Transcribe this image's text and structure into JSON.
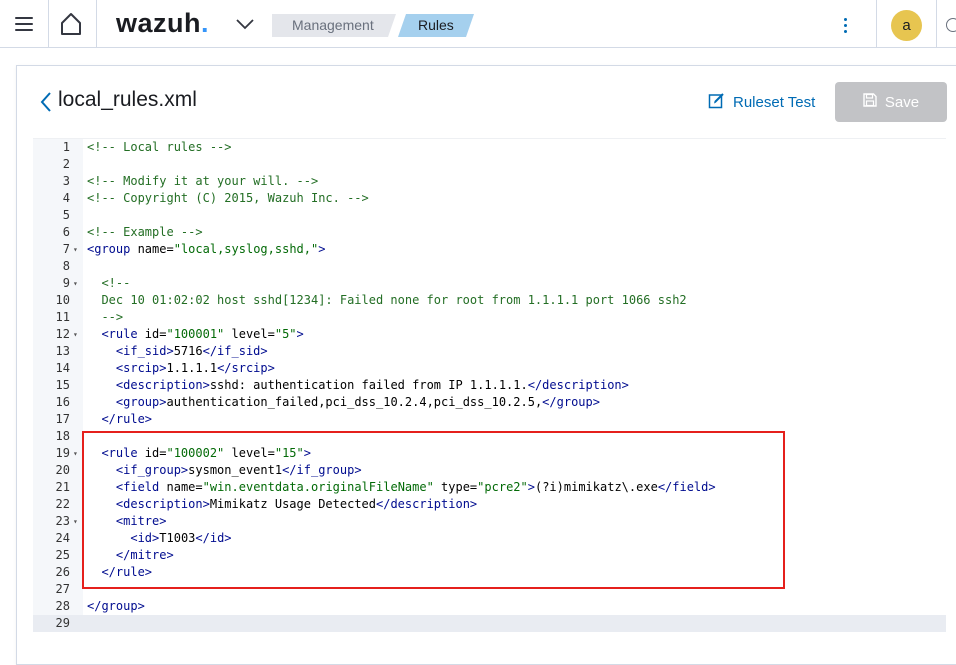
{
  "header": {
    "logo_text": "wazuh",
    "logo_dot": ".",
    "breadcrumbs": [
      "Management",
      "Rules"
    ],
    "avatar_letter": "a"
  },
  "page": {
    "file_name": "local_rules.xml",
    "ruleset_test_label": "Ruleset Test",
    "save_label": "Save"
  },
  "colors": {
    "accent": "#006bb4",
    "logo_dot": "#3595f9",
    "active_crumb": "#a5d0ee",
    "avatar": "#e7c550",
    "highlight_border": "#e5201c"
  },
  "icons": {
    "menu": "hamburger-icon",
    "home": "home-icon",
    "app_switch": "chevron-down-icon",
    "more": "kebab-icon",
    "back": "chevron-left-icon",
    "ruleset": "edit-icon",
    "save": "save-icon"
  },
  "editor": {
    "active_line": 29,
    "lines": [
      {
        "n": "1",
        "fold": false,
        "tokens": [
          [
            "c",
            "<!-- Local rules -->"
          ]
        ]
      },
      {
        "n": "2",
        "fold": false,
        "tokens": []
      },
      {
        "n": "3",
        "fold": false,
        "tokens": [
          [
            "c",
            "<!-- Modify it at your will. -->"
          ]
        ]
      },
      {
        "n": "4",
        "fold": false,
        "tokens": [
          [
            "c",
            "<!-- Copyright (C) 2015, Wazuh Inc. -->"
          ]
        ]
      },
      {
        "n": "5",
        "fold": false,
        "tokens": []
      },
      {
        "n": "6",
        "fold": false,
        "tokens": [
          [
            "c",
            "<!-- Example -->"
          ]
        ]
      },
      {
        "n": "7",
        "fold": true,
        "tokens": [
          [
            "t",
            "<group"
          ],
          [
            "a",
            " name="
          ],
          [
            "v",
            "\"local,syslog,sshd,\""
          ],
          [
            "t",
            ">"
          ]
        ]
      },
      {
        "n": "8",
        "fold": false,
        "tokens": []
      },
      {
        "n": "9",
        "fold": true,
        "tokens": [
          [
            "c",
            "  <!--"
          ]
        ]
      },
      {
        "n": "10",
        "fold": false,
        "tokens": [
          [
            "c",
            "  Dec 10 01:02:02 host sshd[1234]: Failed none for root from 1.1.1.1 port 1066 ssh2"
          ]
        ]
      },
      {
        "n": "11",
        "fold": false,
        "tokens": [
          [
            "c",
            "  -->"
          ]
        ]
      },
      {
        "n": "12",
        "fold": true,
        "tokens": [
          [
            "x",
            "  "
          ],
          [
            "t",
            "<rule"
          ],
          [
            "a",
            " id="
          ],
          [
            "v",
            "\"100001\""
          ],
          [
            "a",
            " level="
          ],
          [
            "v",
            "\"5\""
          ],
          [
            "t",
            ">"
          ]
        ]
      },
      {
        "n": "13",
        "fold": false,
        "tokens": [
          [
            "x",
            "    "
          ],
          [
            "t",
            "<if_sid>"
          ],
          [
            "x",
            "5716"
          ],
          [
            "t",
            "</if_sid>"
          ]
        ]
      },
      {
        "n": "14",
        "fold": false,
        "tokens": [
          [
            "x",
            "    "
          ],
          [
            "t",
            "<srcip>"
          ],
          [
            "x",
            "1.1.1.1"
          ],
          [
            "t",
            "</srcip>"
          ]
        ]
      },
      {
        "n": "15",
        "fold": false,
        "tokens": [
          [
            "x",
            "    "
          ],
          [
            "t",
            "<description>"
          ],
          [
            "x",
            "sshd: authentication failed from IP 1.1.1.1."
          ],
          [
            "t",
            "</description>"
          ]
        ]
      },
      {
        "n": "16",
        "fold": false,
        "tokens": [
          [
            "x",
            "    "
          ],
          [
            "t",
            "<group>"
          ],
          [
            "x",
            "authentication_failed,pci_dss_10.2.4,pci_dss_10.2.5,"
          ],
          [
            "t",
            "</group>"
          ]
        ]
      },
      {
        "n": "17",
        "fold": false,
        "tokens": [
          [
            "x",
            "  "
          ],
          [
            "t",
            "</rule>"
          ]
        ]
      },
      {
        "n": "18",
        "fold": false,
        "tokens": []
      },
      {
        "n": "19",
        "fold": true,
        "tokens": [
          [
            "x",
            "  "
          ],
          [
            "t",
            "<rule"
          ],
          [
            "a",
            " id="
          ],
          [
            "v",
            "\"100002\""
          ],
          [
            "a",
            " level="
          ],
          [
            "v",
            "\"15\""
          ],
          [
            "t",
            ">"
          ]
        ]
      },
      {
        "n": "20",
        "fold": false,
        "tokens": [
          [
            "x",
            "    "
          ],
          [
            "t",
            "<if_group>"
          ],
          [
            "x",
            "sysmon_event1"
          ],
          [
            "t",
            "</if_group>"
          ]
        ]
      },
      {
        "n": "21",
        "fold": false,
        "tokens": [
          [
            "x",
            "    "
          ],
          [
            "t",
            "<field"
          ],
          [
            "a",
            " name="
          ],
          [
            "v",
            "\"win.eventdata.originalFileName\""
          ],
          [
            "a",
            " type="
          ],
          [
            "v",
            "\"pcre2\""
          ],
          [
            "t",
            ">"
          ],
          [
            "x",
            "(?i)mimikatz\\.exe"
          ],
          [
            "t",
            "</field>"
          ]
        ]
      },
      {
        "n": "22",
        "fold": false,
        "tokens": [
          [
            "x",
            "    "
          ],
          [
            "t",
            "<description>"
          ],
          [
            "x",
            "Mimikatz Usage Detected"
          ],
          [
            "t",
            "</description>"
          ]
        ]
      },
      {
        "n": "23",
        "fold": true,
        "tokens": [
          [
            "x",
            "    "
          ],
          [
            "t",
            "<mitre>"
          ]
        ]
      },
      {
        "n": "24",
        "fold": false,
        "tokens": [
          [
            "x",
            "      "
          ],
          [
            "t",
            "<id>"
          ],
          [
            "x",
            "T1003"
          ],
          [
            "t",
            "</id>"
          ]
        ]
      },
      {
        "n": "25",
        "fold": false,
        "tokens": [
          [
            "x",
            "    "
          ],
          [
            "t",
            "</mitre>"
          ]
        ]
      },
      {
        "n": "26",
        "fold": false,
        "tokens": [
          [
            "x",
            "  "
          ],
          [
            "t",
            "</rule>"
          ]
        ]
      },
      {
        "n": "27",
        "fold": false,
        "tokens": []
      },
      {
        "n": "28",
        "fold": false,
        "tokens": [
          [
            "t",
            "</group>"
          ]
        ]
      },
      {
        "n": "29",
        "fold": false,
        "tokens": []
      }
    ]
  }
}
